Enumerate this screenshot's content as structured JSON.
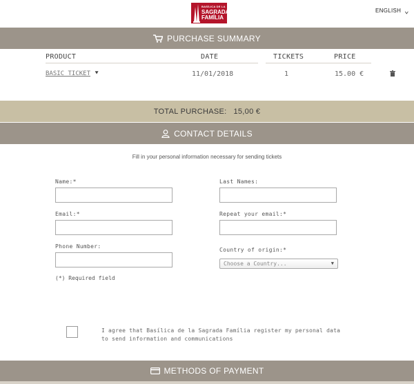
{
  "header": {
    "logo_line1": "BASÍLICA DE LA",
    "logo_line2": "SAGRADA",
    "logo_line3": "FAMÍLIA",
    "language": "ENGLISH"
  },
  "purchase_summary": {
    "title": "PURCHASE SUMMARY",
    "columns": [
      "PRODUCT",
      "DATE",
      "TICKETS",
      "PRICE"
    ],
    "rows": [
      {
        "product": "BASIC TICKET",
        "date": "11/01/2018",
        "tickets": "1",
        "price": "15.00 €"
      }
    ]
  },
  "total": {
    "label": "TOTAL PURCHASE:",
    "value": "15,00 €"
  },
  "contact": {
    "title": "CONTACT DETAILS",
    "intro": "Fill in your personal information necessary for sending tickets",
    "name_label": "Name:*",
    "last_names_label": "Last Names:",
    "email_label": "Email:*",
    "repeat_email_label": "Repeat your email:*",
    "phone_label": "Phone Number:",
    "country_label": "Country of origin:*",
    "country_placeholder": "Choose a Country...",
    "required_note": "(*) Required field",
    "agree_text": "I agree that Basílica de la Sagrada Família register my personal data to send information and communications"
  },
  "payment": {
    "title": "METHODS OF PAYMENT"
  },
  "colors": {
    "band": "#9c948a",
    "total_band": "#c8bfa4",
    "brand_red": "#b4152b"
  }
}
